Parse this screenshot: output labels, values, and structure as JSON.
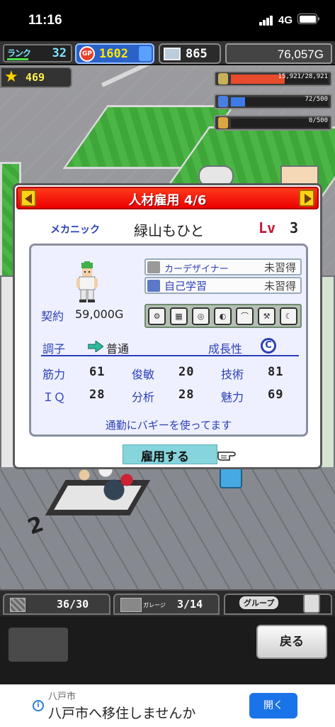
{
  "status_bar": {
    "time": "11:16",
    "network": "4G"
  },
  "hud": {
    "rank_label": "ランク",
    "rank_value": "32",
    "gp_label": "GP",
    "gp_value": "1602",
    "pcs_value": "865",
    "money": "76,057G",
    "stars": "469",
    "resources": [
      {
        "icon": "fuel-barrel-icon",
        "value": "15,921/28,921",
        "fraction": 0.55,
        "color": "#e84a2c"
      },
      {
        "icon": "water-bottle-icon",
        "value": "72/500",
        "fraction": 0.144,
        "color": "#3c7be8"
      },
      {
        "icon": "wheat-icon",
        "value": "0/500",
        "fraction": 0.0,
        "color": "#d9a640"
      }
    ]
  },
  "dialog": {
    "title": "人材雇用 4/6",
    "job": "メカニック",
    "name": "緑山もひと",
    "lv_label": "Lv",
    "lv_value": "3",
    "contract_label": "契約",
    "contract_value": "59,000G",
    "skills": [
      {
        "name": "カーデザイナー",
        "status": "未習得",
        "icon": "car-designer-icon"
      },
      {
        "name": "自己学習",
        "status": "未習得",
        "icon": "self-study-icon"
      }
    ],
    "ability_icons": [
      "engine-icon",
      "chassis-icon",
      "tire-icon",
      "helmet-icon",
      "wrench-icon",
      "hammer-icon",
      "moon-icon"
    ],
    "condition_label": "調子",
    "condition_value": "普通",
    "growth_label": "成長性",
    "growth_value": "C",
    "stats": [
      {
        "label": "筋力",
        "value": "61"
      },
      {
        "label": "俊敏",
        "value": "20"
      },
      {
        "label": "技術",
        "value": "81"
      },
      {
        "label": "ＩＱ",
        "value": "28"
      },
      {
        "label": "分析",
        "value": "28"
      },
      {
        "label": "魅力",
        "value": "69"
      }
    ],
    "comment": "通勤にバギーを使ってます",
    "hire_button": "雇用する"
  },
  "bottom": {
    "staff_count": "36/30",
    "garage_label": "ガレージ",
    "garage_count": "3/14",
    "group_label": "グループ",
    "back_button": "戻る"
  },
  "ad": {
    "small_text": "八戸市",
    "main_text": "八戸市へ移住しませんか",
    "button": "開く"
  },
  "colors": {
    "dialog_header": "#e00000",
    "accent_blue": "#2b3fb6",
    "hire_button": "#86d4dc"
  }
}
